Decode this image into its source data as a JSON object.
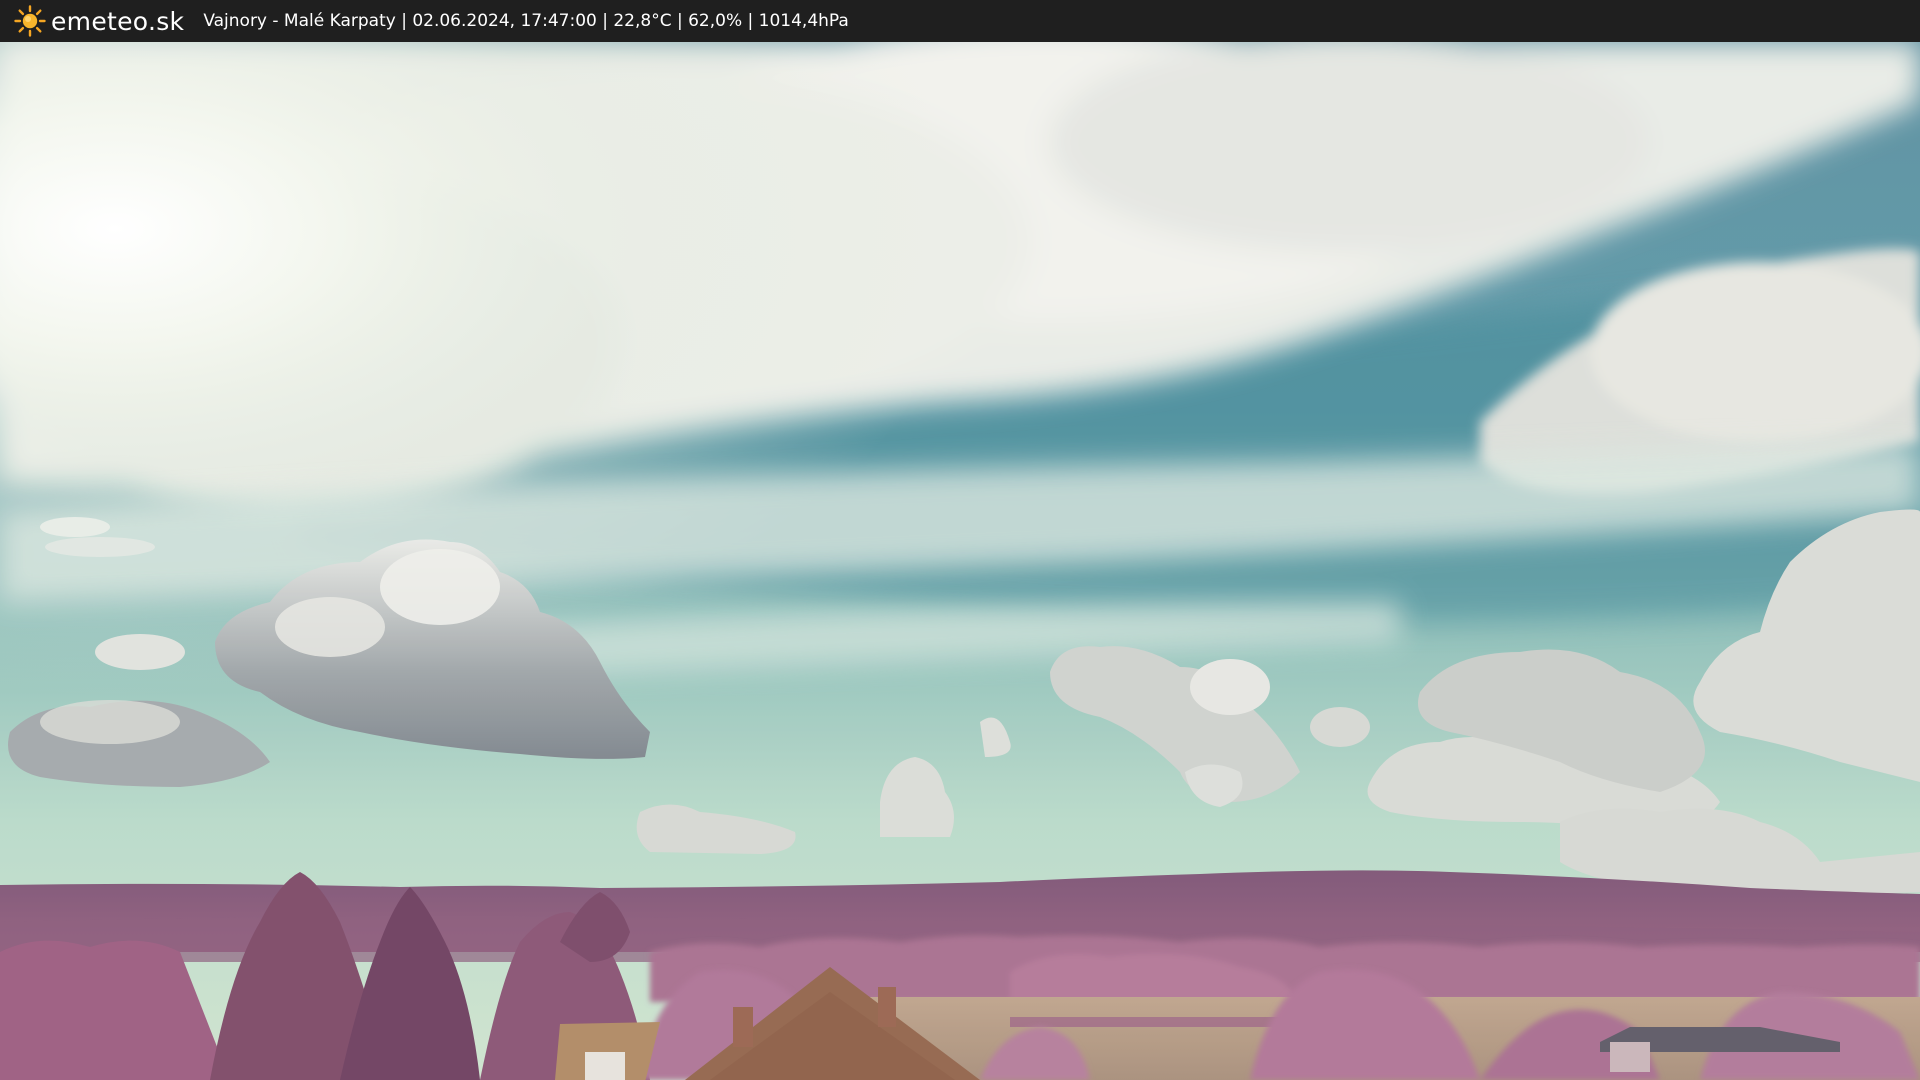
{
  "header": {
    "brand": "emeteo.sk",
    "brand_icon": "sun-icon",
    "caption": "Vajnory - Malé Karpaty | 02.06.2024, 17:47:00 | 22,8°C | 62,0% | 1014,4hPa"
  },
  "colors": {
    "bar_background": "#1f1f1f",
    "brand_sun": "#f5a623",
    "sky_top": "#3f7f90",
    "sky_horizon": "#bfdcc8",
    "hills": "#8a5a78",
    "trees": "#a86a8e",
    "field": "#b69c86",
    "roof": "#8b5a40"
  }
}
